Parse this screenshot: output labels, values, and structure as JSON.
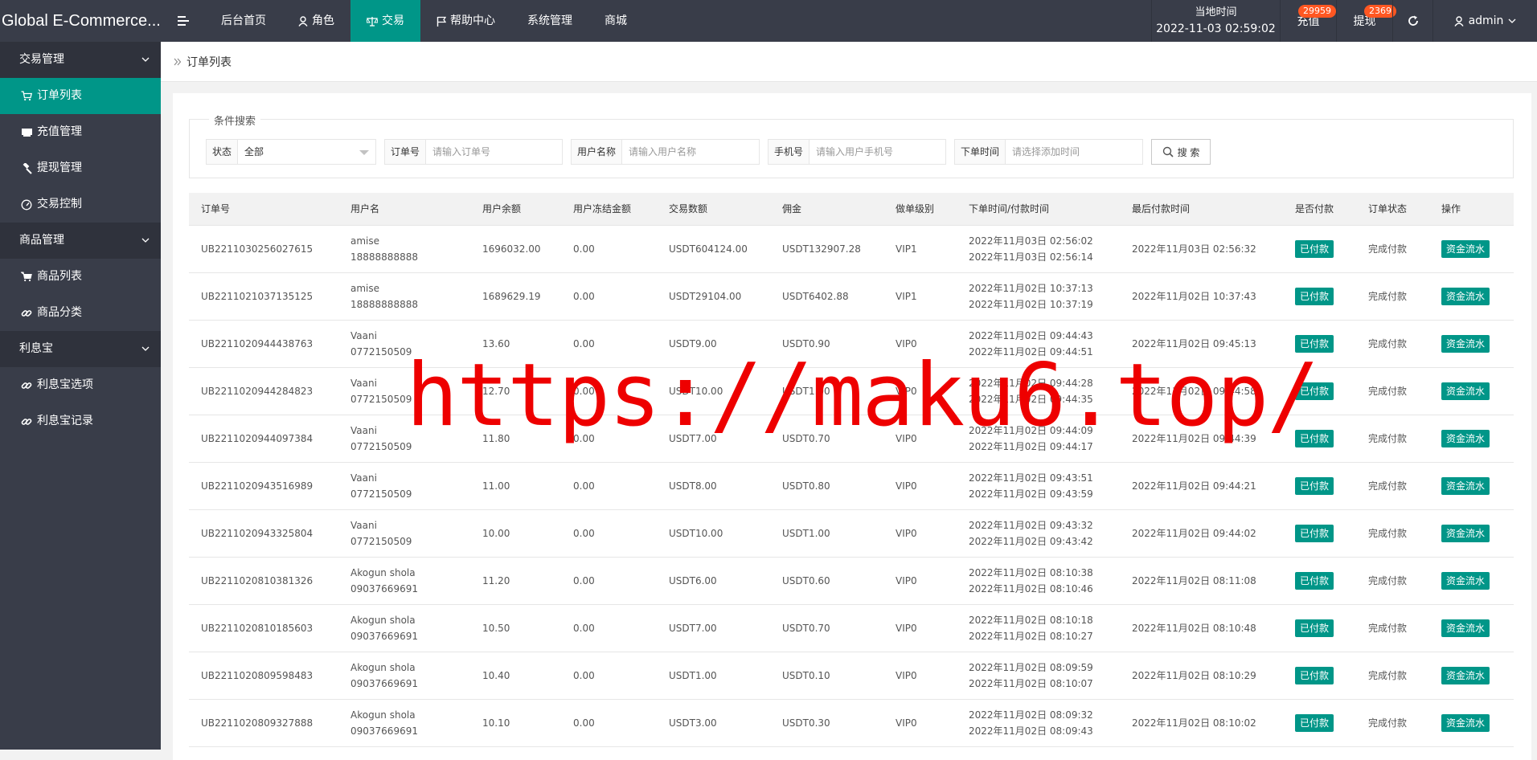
{
  "app": {
    "title": "Global E-Commerce..."
  },
  "topnav": {
    "items": [
      {
        "label": "后台首页",
        "icon": "none"
      },
      {
        "label": "角色",
        "icon": "user-icon"
      },
      {
        "label": "交易",
        "icon": "scale-icon"
      },
      {
        "label": "帮助中心",
        "icon": "flag-icon"
      },
      {
        "label": "系统管理",
        "icon": "none"
      },
      {
        "label": "商城",
        "icon": "none"
      }
    ],
    "active": "交易"
  },
  "header_right": {
    "clock_label": "当地时间",
    "clock_value": "2022-11-03 02:59:02",
    "recharge_label": "充值",
    "recharge_badge": "29959",
    "withdraw_label": "提现",
    "withdraw_badge": "2369",
    "user_name": "admin"
  },
  "sidebar": {
    "groups": [
      {
        "label": "交易管理",
        "items": [
          "订单列表",
          "充值管理",
          "提现管理",
          "交易控制"
        ]
      },
      {
        "label": "商品管理",
        "items": [
          "商品列表",
          "商品分类"
        ]
      },
      {
        "label": "利息宝",
        "items": [
          "利息宝选项",
          "利息宝记录"
        ]
      }
    ],
    "active_item": "订单列表"
  },
  "breadcrumb": {
    "current": "订单列表"
  },
  "search": {
    "legend": "条件搜索",
    "status_label": "状态",
    "status_value": "全部",
    "order_label": "订单号",
    "order_placeholder": "请输入订单号",
    "username_label": "用户名称",
    "username_placeholder": "请输入用户名称",
    "phone_label": "手机号",
    "phone_placeholder": "请输入用户手机号",
    "time_label": "下单时间",
    "time_placeholder": "请选择添加时间",
    "button_label": "搜 索"
  },
  "table": {
    "headers": [
      "订单号",
      "用户名",
      "用户余额",
      "用户冻结金额",
      "交易数额",
      "佣金",
      "做单级别",
      "下单时间/付款时间",
      "最后付款时间",
      "是否付款",
      "订单状态",
      "操作"
    ],
    "rows": [
      {
        "order": "UB2211030256027615",
        "user": "amise",
        "phone": "18888888888",
        "balance": "1696032.00",
        "frozen": "0.00",
        "amount": "USDT604124.00",
        "commission": "USDT132907.28",
        "level": "VIP1",
        "order_time": "2022年11月03日 02:56:02",
        "pay_time": "2022年11月03日 02:56:14",
        "last_pay": "2022年11月03日 02:56:32",
        "paid": "已付款",
        "status": "完成付款",
        "action": "资金流水"
      },
      {
        "order": "UB2211021037135125",
        "user": "amise",
        "phone": "18888888888",
        "balance": "1689629.19",
        "frozen": "0.00",
        "amount": "USDT29104.00",
        "commission": "USDT6402.88",
        "level": "VIP1",
        "order_time": "2022年11月02日 10:37:13",
        "pay_time": "2022年11月02日 10:37:19",
        "last_pay": "2022年11月02日 10:37:43",
        "paid": "已付款",
        "status": "完成付款",
        "action": "资金流水"
      },
      {
        "order": "UB2211020944438763",
        "user": "Vaani",
        "phone": "0772150509",
        "balance": "13.60",
        "frozen": "0.00",
        "amount": "USDT9.00",
        "commission": "USDT0.90",
        "level": "VIP0",
        "order_time": "2022年11月02日 09:44:43",
        "pay_time": "2022年11月02日 09:44:51",
        "last_pay": "2022年11月02日 09:45:13",
        "paid": "已付款",
        "status": "完成付款",
        "action": "资金流水"
      },
      {
        "order": "UB2211020944284823",
        "user": "Vaani",
        "phone": "0772150509",
        "balance": "12.70",
        "frozen": "0.00",
        "amount": "USDT10.00",
        "commission": "USDT1.00",
        "level": "VIP0",
        "order_time": "2022年11月02日 09:44:28",
        "pay_time": "2022年11月02日 09:44:35",
        "last_pay": "2022年11月02日 09:44:58",
        "paid": "已付款",
        "status": "完成付款",
        "action": "资金流水"
      },
      {
        "order": "UB2211020944097384",
        "user": "Vaani",
        "phone": "0772150509",
        "balance": "11.80",
        "frozen": "0.00",
        "amount": "USDT7.00",
        "commission": "USDT0.70",
        "level": "VIP0",
        "order_time": "2022年11月02日 09:44:09",
        "pay_time": "2022年11月02日 09:44:17",
        "last_pay": "2022年11月02日 09:44:39",
        "paid": "已付款",
        "status": "完成付款",
        "action": "资金流水"
      },
      {
        "order": "UB2211020943516989",
        "user": "Vaani",
        "phone": "0772150509",
        "balance": "11.00",
        "frozen": "0.00",
        "amount": "USDT8.00",
        "commission": "USDT0.80",
        "level": "VIP0",
        "order_time": "2022年11月02日 09:43:51",
        "pay_time": "2022年11月02日 09:43:59",
        "last_pay": "2022年11月02日 09:44:21",
        "paid": "已付款",
        "status": "完成付款",
        "action": "资金流水"
      },
      {
        "order": "UB2211020943325804",
        "user": "Vaani",
        "phone": "0772150509",
        "balance": "10.00",
        "frozen": "0.00",
        "amount": "USDT10.00",
        "commission": "USDT1.00",
        "level": "VIP0",
        "order_time": "2022年11月02日 09:43:32",
        "pay_time": "2022年11月02日 09:43:42",
        "last_pay": "2022年11月02日 09:44:02",
        "paid": "已付款",
        "status": "完成付款",
        "action": "资金流水"
      },
      {
        "order": "UB2211020810381326",
        "user": "Akogun shola",
        "phone": "09037669691",
        "balance": "11.20",
        "frozen": "0.00",
        "amount": "USDT6.00",
        "commission": "USDT0.60",
        "level": "VIP0",
        "order_time": "2022年11月02日 08:10:38",
        "pay_time": "2022年11月02日 08:10:46",
        "last_pay": "2022年11月02日 08:11:08",
        "paid": "已付款",
        "status": "完成付款",
        "action": "资金流水"
      },
      {
        "order": "UB2211020810185603",
        "user": "Akogun shola",
        "phone": "09037669691",
        "balance": "10.50",
        "frozen": "0.00",
        "amount": "USDT7.00",
        "commission": "USDT0.70",
        "level": "VIP0",
        "order_time": "2022年11月02日 08:10:18",
        "pay_time": "2022年11月02日 08:10:27",
        "last_pay": "2022年11月02日 08:10:48",
        "paid": "已付款",
        "status": "完成付款",
        "action": "资金流水"
      },
      {
        "order": "UB2211020809598483",
        "user": "Akogun shola",
        "phone": "09037669691",
        "balance": "10.40",
        "frozen": "0.00",
        "amount": "USDT1.00",
        "commission": "USDT0.10",
        "level": "VIP0",
        "order_time": "2022年11月02日 08:09:59",
        "pay_time": "2022年11月02日 08:10:07",
        "last_pay": "2022年11月02日 08:10:29",
        "paid": "已付款",
        "status": "完成付款",
        "action": "资金流水"
      },
      {
        "order": "UB2211020809327888",
        "user": "Akogun shola",
        "phone": "09037669691",
        "balance": "10.10",
        "frozen": "0.00",
        "amount": "USDT3.00",
        "commission": "USDT0.30",
        "level": "VIP0",
        "order_time": "2022年11月02日 08:09:32",
        "pay_time": "2022年11月02日 08:09:43",
        "last_pay": "2022年11月02日 08:10:02",
        "paid": "已付款",
        "status": "完成付款",
        "action": "资金流水"
      }
    ]
  },
  "watermark": "https://maku6.top/",
  "colors": {
    "accent": "#009688",
    "topbar": "#393d49",
    "badge": "#ff5722",
    "watermark": "#ee0000"
  }
}
